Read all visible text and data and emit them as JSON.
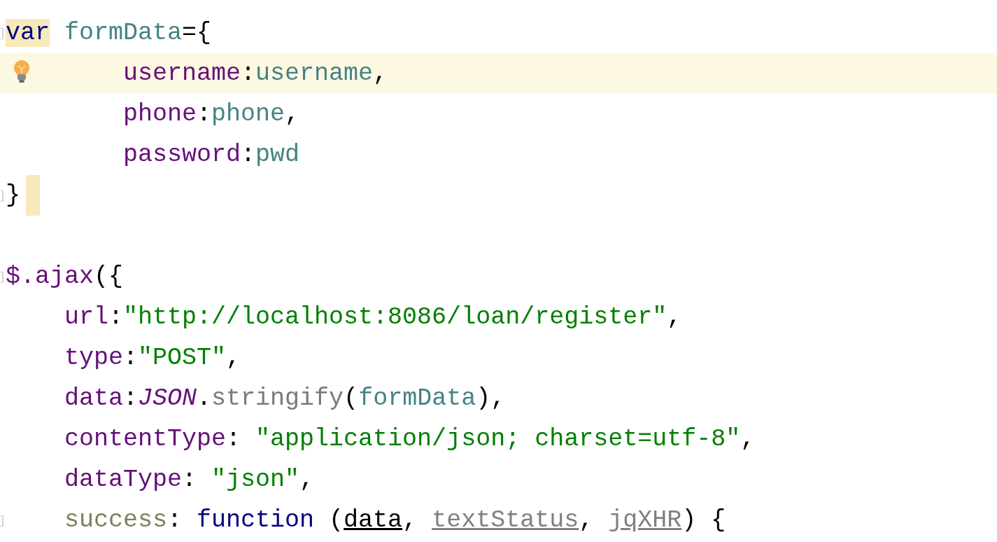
{
  "editor": {
    "lines": [
      {
        "fold": true,
        "current": false,
        "bulb": false,
        "caret_block": false,
        "tokens": [
          {
            "text": "var",
            "kind": "keyword",
            "highlight": true
          },
          {
            "text": " formData",
            "kind": "variable",
            "highlight": false
          },
          {
            "text": "={",
            "kind": "punct",
            "highlight": false
          }
        ]
      },
      {
        "fold": false,
        "current": true,
        "bulb": true,
        "caret_block": false,
        "tokens": [
          {
            "text": "        username",
            "kind": "property",
            "highlight": false
          },
          {
            "text": ":",
            "kind": "punct",
            "highlight": false
          },
          {
            "text": "username",
            "kind": "variable",
            "highlight": false
          },
          {
            "text": ",",
            "kind": "punct",
            "highlight": false
          }
        ]
      },
      {
        "fold": false,
        "current": false,
        "bulb": false,
        "caret_block": false,
        "tokens": [
          {
            "text": "        phone",
            "kind": "property",
            "highlight": false
          },
          {
            "text": ":",
            "kind": "punct",
            "highlight": false
          },
          {
            "text": "phone",
            "kind": "variable",
            "highlight": false
          },
          {
            "text": ",",
            "kind": "punct",
            "highlight": false
          }
        ]
      },
      {
        "fold": false,
        "current": false,
        "bulb": false,
        "caret_block": false,
        "tokens": [
          {
            "text": "        password",
            "kind": "property",
            "highlight": false
          },
          {
            "text": ":",
            "kind": "punct",
            "highlight": false
          },
          {
            "text": "pwd",
            "kind": "variable",
            "highlight": false
          }
        ]
      },
      {
        "fold": true,
        "current": false,
        "bulb": false,
        "caret_block": true,
        "tokens": [
          {
            "text": "}",
            "kind": "punct",
            "highlight": false
          }
        ]
      },
      {
        "fold": false,
        "current": false,
        "bulb": false,
        "caret_block": false
      },
      {
        "fold": true,
        "current": false,
        "bulb": false,
        "caret_block": false,
        "tokens": [
          {
            "text": "$.",
            "kind": "property",
            "highlight": false
          },
          {
            "text": "ajax",
            "kind": "property",
            "highlight": false
          },
          {
            "text": "({",
            "kind": "punct",
            "highlight": false
          }
        ]
      },
      {
        "fold": false,
        "current": false,
        "bulb": false,
        "caret_block": false,
        "tokens": [
          {
            "text": "    url",
            "kind": "property",
            "highlight": false
          },
          {
            "text": ":",
            "kind": "punct",
            "highlight": false
          },
          {
            "text": "\"http://localhost:8086/loan/register\"",
            "kind": "string",
            "highlight": false
          },
          {
            "text": ",",
            "kind": "punct",
            "highlight": false
          }
        ]
      },
      {
        "fold": false,
        "current": false,
        "bulb": false,
        "caret_block": false,
        "tokens": [
          {
            "text": "    type",
            "kind": "property",
            "highlight": false
          },
          {
            "text": ":",
            "kind": "punct",
            "highlight": false
          },
          {
            "text": "\"POST\"",
            "kind": "string",
            "highlight": false
          },
          {
            "text": ",",
            "kind": "punct",
            "highlight": false
          }
        ]
      },
      {
        "fold": false,
        "current": false,
        "bulb": false,
        "caret_block": false,
        "tokens": [
          {
            "text": "    data",
            "kind": "property",
            "highlight": false
          },
          {
            "text": ":",
            "kind": "punct",
            "highlight": false
          },
          {
            "text": "JSON",
            "kind": "global",
            "highlight": false
          },
          {
            "text": ".",
            "kind": "punct",
            "highlight": false
          },
          {
            "text": "stringify",
            "kind": "method",
            "highlight": false
          },
          {
            "text": "(",
            "kind": "punct",
            "highlight": false
          },
          {
            "text": "formData",
            "kind": "variable",
            "highlight": false
          },
          {
            "text": "),",
            "kind": "punct",
            "highlight": false
          }
        ]
      },
      {
        "fold": false,
        "current": false,
        "bulb": false,
        "caret_block": false,
        "tokens": [
          {
            "text": "    contentType",
            "kind": "property",
            "highlight": false
          },
          {
            "text": ": ",
            "kind": "punct",
            "highlight": false
          },
          {
            "text": "\"application/json; charset=utf-8\"",
            "kind": "string",
            "highlight": false
          },
          {
            "text": ",",
            "kind": "punct",
            "highlight": false
          }
        ]
      },
      {
        "fold": false,
        "current": false,
        "bulb": false,
        "caret_block": false,
        "tokens": [
          {
            "text": "    dataType",
            "kind": "property",
            "highlight": false
          },
          {
            "text": ": ",
            "kind": "punct",
            "highlight": false
          },
          {
            "text": "\"json\"",
            "kind": "string",
            "highlight": false
          },
          {
            "text": ",",
            "kind": "punct",
            "highlight": false
          }
        ]
      },
      {
        "fold": true,
        "current": false,
        "bulb": false,
        "caret_block": false,
        "tokens": [
          {
            "text": "    success",
            "kind": "unused",
            "highlight": false
          },
          {
            "text": ": ",
            "kind": "punct",
            "highlight": false
          },
          {
            "text": "function",
            "kind": "keyword",
            "highlight": false
          },
          {
            "text": " (",
            "kind": "punct",
            "highlight": false
          },
          {
            "text": "data",
            "kind": "param",
            "highlight": false
          },
          {
            "text": ", ",
            "kind": "punct",
            "highlight": false
          },
          {
            "text": "textStatus",
            "kind": "unused-param",
            "highlight": false
          },
          {
            "text": ", ",
            "kind": "punct",
            "highlight": false
          },
          {
            "text": "jqXHR",
            "kind": "unused-param",
            "highlight": false
          },
          {
            "text": ") {",
            "kind": "punct",
            "highlight": false
          }
        ]
      }
    ]
  }
}
